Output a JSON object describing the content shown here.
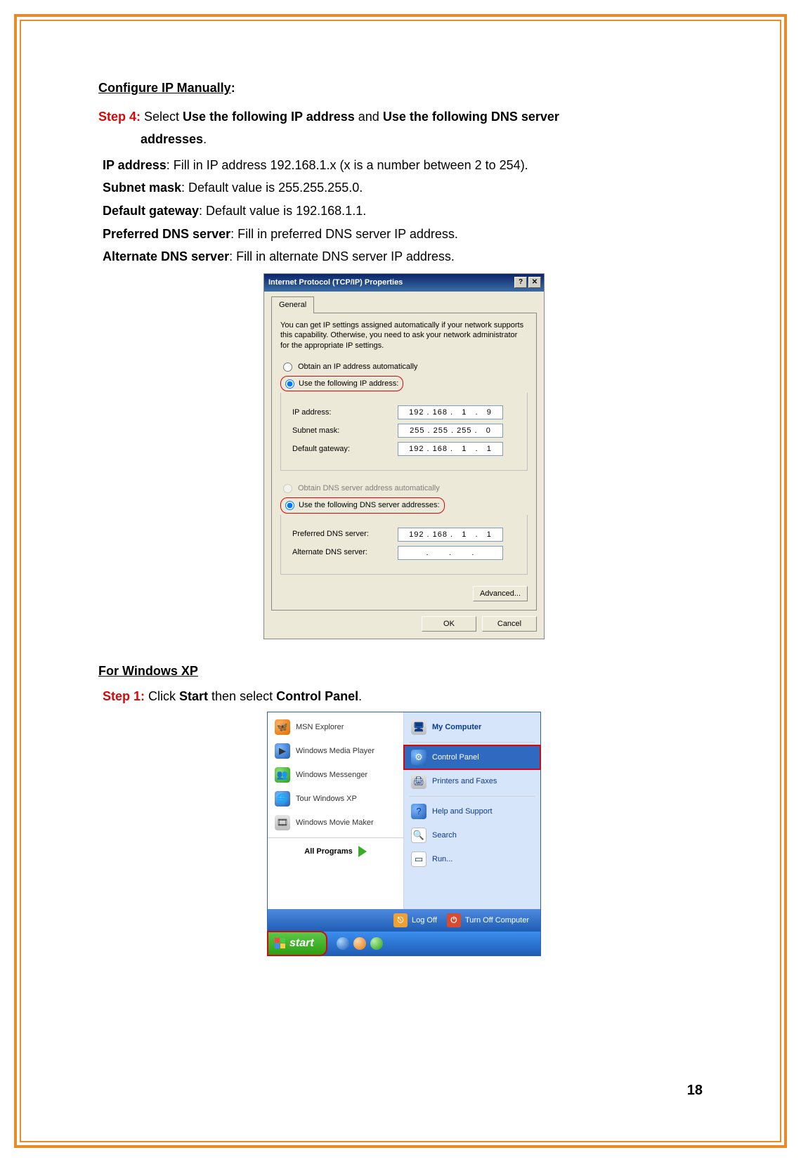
{
  "doc": {
    "configure_heading": "Configure IP Manually",
    "configure_colon": ":",
    "step4_label": "Step 4:",
    "step4_a": " Select ",
    "step4_b": "Use the following IP address",
    "step4_c": " and ",
    "step4_d": "Use the following DNS server",
    "step4_e": "addresses",
    "step4_dot": ".",
    "ip_address_label": "IP address",
    "ip_address_text": ": Fill in IP address 192.168.1.x (x is a number between 2 to 254).",
    "subnet_label": "Subnet mask",
    "subnet_text": ": Default value is 255.255.255.0.",
    "gateway_label": "Default gateway",
    "gateway_text": ": Default value is 192.168.1.1.",
    "pdns_label": "Preferred DNS server",
    "pdns_text": ": Fill in preferred DNS server IP address.",
    "adns_label": "Alternate DNS server",
    "adns_text": ": Fill in alternate DNS server IP address.",
    "xp_heading": "For Windows XP",
    "step1_label": "Step 1:",
    "step1_a": " Click ",
    "step1_b": "Start",
    "step1_c": " then select ",
    "step1_d": "Control Panel",
    "step1_dot": "."
  },
  "dialog": {
    "title": "Internet Protocol (TCP/IP) Properties",
    "help_btn": "?",
    "close_btn": "✕",
    "tab": "General",
    "description": "You can get IP settings assigned automatically if your network supports this capability. Otherwise, you need to ask your network administrator for the appropriate IP settings.",
    "obtain_ip": "Obtain an IP address automatically",
    "use_ip": "Use the following IP address:",
    "ip_addr_label": "IP address:",
    "ip_addr_value": "192 . 168 .   1   .   9",
    "subnet_label": "Subnet mask:",
    "subnet_value": "255 . 255 . 255 .   0",
    "gateway_label": "Default gateway:",
    "gateway_value": "192 . 168 .   1   .   1",
    "obtain_dns": "Obtain DNS server address automatically",
    "use_dns": "Use the following DNS server addresses:",
    "pref_dns_label": "Preferred DNS server:",
    "pref_dns_value": "192 . 168 .   1   .   1",
    "alt_dns_label": "Alternate DNS server:",
    "alt_dns_value": ".       .       .",
    "advanced": "Advanced...",
    "ok": "OK",
    "cancel": "Cancel"
  },
  "startmenu": {
    "left": {
      "msn": "MSN Explorer",
      "wmp": "Windows Media Player",
      "msgr": "Windows Messenger",
      "tour": "Tour Windows XP",
      "movie": "Windows Movie Maker",
      "all_programs": "All Programs"
    },
    "right": {
      "mycomputer": "My Computer",
      "controlpanel": "Control Panel",
      "printers": "Printers and Faxes",
      "help": "Help and Support",
      "search": "Search",
      "run": "Run..."
    },
    "footer": {
      "logoff": "Log Off",
      "turnoff": "Turn Off Computer"
    },
    "start": "start"
  },
  "page_number": "18"
}
